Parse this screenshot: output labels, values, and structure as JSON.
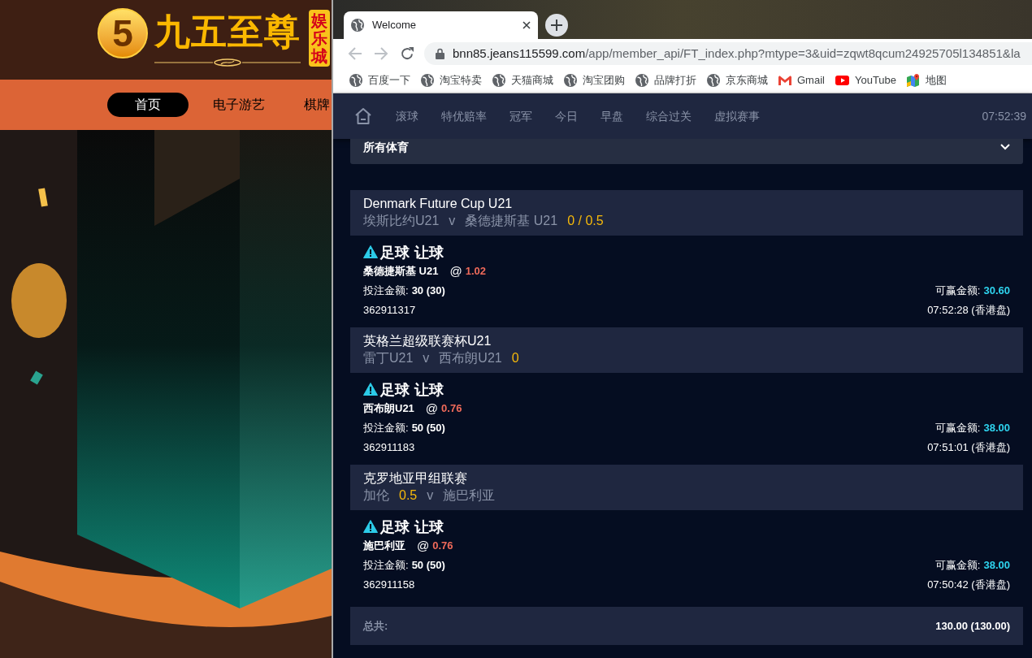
{
  "site": {
    "logo": {
      "mark": "5",
      "title": "九五至尊",
      "badge": "娱乐城"
    },
    "nav": [
      {
        "label": "首页",
        "selected": true
      },
      {
        "label": "电子游艺",
        "selected": false
      },
      {
        "label": "棋牌",
        "selected": false
      }
    ]
  },
  "browser": {
    "tabs": [
      {
        "title": "Welcome",
        "selected": true
      }
    ],
    "toolbar": [
      {
        "kind": "back",
        "disabled": true
      },
      {
        "kind": "forward",
        "disabled": true
      },
      {
        "kind": "reload",
        "disabled": false
      }
    ],
    "address": {
      "host": "bnn85.jeans115599.com",
      "path": "/app/member_api/FT_index.php?mtype=3&uid=zqwt8qcum24925705l134851&la"
    },
    "bookmarks": [
      {
        "kind": "globe",
        "label": "百度一下"
      },
      {
        "kind": "globe",
        "label": "淘宝特卖"
      },
      {
        "kind": "globe",
        "label": "天猫商城"
      },
      {
        "kind": "globe",
        "label": "淘宝团购"
      },
      {
        "kind": "globe",
        "label": "品牌打折"
      },
      {
        "kind": "globe",
        "label": "京东商城"
      },
      {
        "kind": "gmail",
        "label": "Gmail"
      },
      {
        "kind": "youtube",
        "label": "YouTube"
      },
      {
        "kind": "maps",
        "label": "地图"
      }
    ]
  },
  "page": {
    "nav": {
      "tabs": [
        {
          "label": "滚球",
          "selected": false
        },
        {
          "label": "特优赔率",
          "selected": false
        },
        {
          "label": "冠军",
          "selected": false
        },
        {
          "label": "今日",
          "selected": false
        },
        {
          "label": "早盘",
          "selected": false
        },
        {
          "label": "综合过关",
          "selected": false
        },
        {
          "label": "虚拟赛事",
          "selected": false
        }
      ],
      "time": "07:52:39"
    },
    "sport_filter": {
      "value": "所有体育"
    },
    "bets": [
      {
        "league": "Denmark Future Cup U21",
        "match": [
          {
            "kind": "team",
            "text": "埃斯比约U21"
          },
          {
            "kind": "vs",
            "text": "v"
          },
          {
            "kind": "team",
            "text": "桑德捷斯基 U21"
          },
          {
            "kind": "handicap",
            "text": "0 / 0.5"
          }
        ],
        "bet_type": "足球 让球",
        "pick": "桑德捷斯基 U21",
        "at": "@",
        "odds": "1.02",
        "stake_label": "投注金额:",
        "stake": "30 (30)",
        "win_label": "可赢金额:",
        "win": "30.60",
        "ticket": "362911317",
        "time": "07:52:28 (香港盘)"
      },
      {
        "league": "英格兰超级联赛杯U21",
        "match": [
          {
            "kind": "team",
            "text": "雷丁U21"
          },
          {
            "kind": "vs",
            "text": "v"
          },
          {
            "kind": "team",
            "text": "西布朗U21"
          },
          {
            "kind": "handicap",
            "text": "0"
          }
        ],
        "bet_type": "足球 让球",
        "pick": "西布朗U21",
        "at": "@",
        "odds": "0.76",
        "stake_label": "投注金额:",
        "stake": "50 (50)",
        "win_label": "可赢金额:",
        "win": "38.00",
        "ticket": "362911183",
        "time": "07:51:01 (香港盘)"
      },
      {
        "league": "克罗地亚甲组联赛",
        "match": [
          {
            "kind": "team",
            "text": "加伦"
          },
          {
            "kind": "handicap",
            "text": "0.5"
          },
          {
            "kind": "vs",
            "text": "v"
          },
          {
            "kind": "team",
            "text": "施巴利亚"
          }
        ],
        "bet_type": "足球 让球",
        "pick": "施巴利亚",
        "at": "@",
        "odds": "0.76",
        "stake_label": "投注金额:",
        "stake": "50 (50)",
        "win_label": "可赢金额:",
        "win": "38.00",
        "ticket": "362911158",
        "time": "07:50:42 (香港盘)"
      }
    ],
    "total": {
      "label": "总共:",
      "value": "130.00 (130.00)"
    }
  }
}
